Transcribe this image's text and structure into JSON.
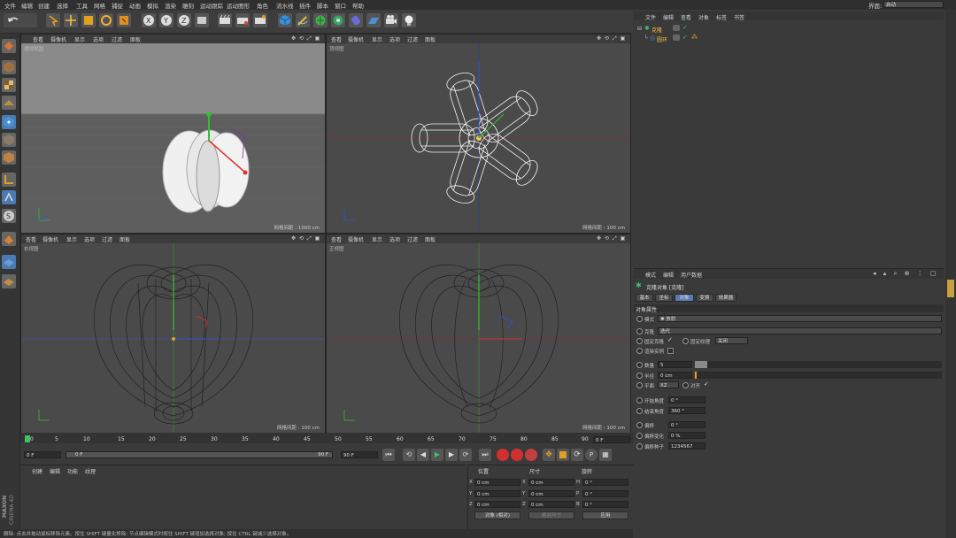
{
  "menubar": {
    "items": [
      "文件",
      "编辑",
      "创建",
      "选择",
      "工具",
      "网格",
      "捕捉",
      "动画",
      "模拟",
      "渲染",
      "雕刻",
      "运动跟踪",
      "运动图形",
      "角色",
      "流水线",
      "插件",
      "脚本",
      "窗口",
      "帮助"
    ],
    "layout_label": "界面:",
    "layout_value": "启动"
  },
  "viewports": [
    {
      "menu": [
        "查看",
        "摄像机",
        "显示",
        "选项",
        "过滤",
        "面板"
      ],
      "label": "透视视图",
      "grid": "网格间距 : 1000 cm"
    },
    {
      "menu": [
        "查看",
        "摄像机",
        "显示",
        "选项",
        "过滤",
        "面板"
      ],
      "label": "顶视图",
      "grid": "网格间距 : 100 cm"
    },
    {
      "menu": [
        "查看",
        "摄像机",
        "显示",
        "选项",
        "过滤",
        "面板"
      ],
      "label": "右视图",
      "grid": "网格间距 : 100 cm"
    },
    {
      "menu": [
        "查看",
        "摄像机",
        "显示",
        "选项",
        "过滤",
        "面板"
      ],
      "label": "正视图",
      "grid": "网格间距 : 100 cm"
    }
  ],
  "object_manager": {
    "menu": [
      "文件",
      "编辑",
      "查看",
      "对象",
      "标签",
      "书签"
    ],
    "objects": [
      "克隆",
      "圆环"
    ]
  },
  "attributes": {
    "menu": [
      "模式",
      "编辑",
      "用户数据"
    ],
    "title": "克隆对象 [克隆]",
    "tabs": [
      "基本",
      "坐标",
      "对象",
      "变换",
      "效果器"
    ],
    "section": "对象属性",
    "mode_label": "模式",
    "mode_value": "放射",
    "clone_label": "克隆",
    "clone_value": "迭代",
    "fix_clone_label": "固定克隆",
    "fix_texture_label": "固定纹理",
    "fix_texture_value": "关闭",
    "render_instance_label": "渲染实例",
    "count_label": "数量",
    "count_value": "5",
    "radius_label": "半径",
    "radius_value": "0 cm",
    "plane_label": "平面",
    "plane_value": "XZ",
    "align_label": "对齐",
    "start_angle_label": "开始角度",
    "start_angle_value": "0 °",
    "end_angle_label": "结束角度",
    "end_angle_value": "360 °",
    "offset_label": "偏移",
    "offset_value": "0 °",
    "offset_var_label": "偏移变化",
    "offset_var_value": "0 %",
    "offset_seed_label": "偏移种子",
    "offset_seed_value": "1234567"
  },
  "timeline": {
    "ticks": [
      "0",
      "5",
      "10",
      "15",
      "20",
      "25",
      "30",
      "35",
      "40",
      "45",
      "50",
      "55",
      "60",
      "65",
      "70",
      "75",
      "80",
      "85",
      "90"
    ],
    "frame_field": "0 F",
    "current_start": "0 F",
    "current_inner": "0 F",
    "end_inner": "90 F",
    "end_field": "90 F"
  },
  "material_manager": {
    "menu": [
      "创建",
      "编辑",
      "功能",
      "纹理"
    ]
  },
  "coordinates": {
    "headers": [
      "位置",
      "尺寸",
      "旋转"
    ],
    "rows": [
      {
        "a": "X",
        "av": "0 cm",
        "b": "X",
        "bv": "0 cm",
        "c": "H",
        "cv": "0 °"
      },
      {
        "a": "Y",
        "av": "0 cm",
        "b": "Y",
        "bv": "0 cm",
        "c": "P",
        "cv": "0 °"
      },
      {
        "a": "Z",
        "av": "0 cm",
        "b": "Z",
        "bv": "0 cm",
        "c": "B",
        "cv": "0 °"
      }
    ],
    "mode_button": "对象 (相对)",
    "size_button": "绝对尺寸",
    "apply_button": "应用"
  },
  "statusbar": {
    "text": "删除: 点击并拖动鼠标移除元素。按住 SHIFT 键量化移除; 节点编辑模式时按住 SHIFT 键增加选择对象; 按住 CTRL 键减少选择对象。"
  },
  "brand": {
    "line1": "MAXON",
    "line2": "CINEMA 4D"
  },
  "colors": {
    "accent": "#f0a020",
    "axis_x": "#e03030",
    "axis_y": "#30c030",
    "axis_z": "#3050e0"
  }
}
